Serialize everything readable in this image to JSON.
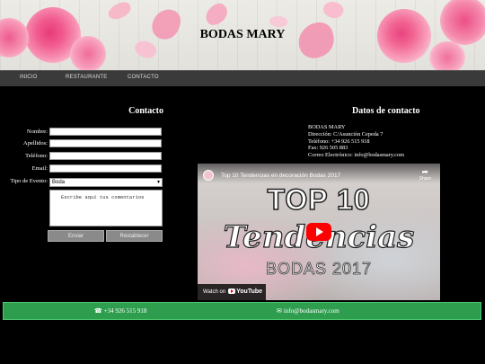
{
  "header": {
    "title": "BODAS MARY"
  },
  "nav": {
    "items": [
      "INICIO",
      "RESTAURANTE",
      "CONTACTO"
    ]
  },
  "form": {
    "title": "Contacto",
    "labels": {
      "nombre": "Nombre:",
      "apellidos": "Apellidos:",
      "telefono": "Teléfono:",
      "email": "Email:",
      "tipo": "Tipo de Evento:"
    },
    "tipo_value": "Boda",
    "comment_placeholder": "Escribe aquí tus comentarios",
    "submit_label": "Enviar",
    "reset_label": "Restablecer"
  },
  "info": {
    "title": "Datos de contacto",
    "lines": [
      "BODAS MARY",
      "Dirección: C/Asunción Cepeda 7",
      "Teléfono: +34 926 515 918",
      "Fax: 926 505 883",
      "Correo Electrónico: info@bodasmary.com"
    ]
  },
  "video": {
    "title": "Top 10 Tendencias en decoración Bodas 2017",
    "share_label": "Share",
    "overlay_top": "TOP 10",
    "overlay_script": "Tendencias",
    "overlay_sub": "BODAS 2017",
    "watch_label": "Watch on",
    "platform": "YouTube"
  },
  "footer": {
    "phone": "+34 926 515 918",
    "email": "info@bodasmary.com",
    "phone_icon": "phone-icon",
    "email_icon": "envelope-icon"
  },
  "colors": {
    "footer_bg": "#2e9e4e",
    "nav_bg": "#3a3a3a",
    "page_bg": "#000000"
  }
}
